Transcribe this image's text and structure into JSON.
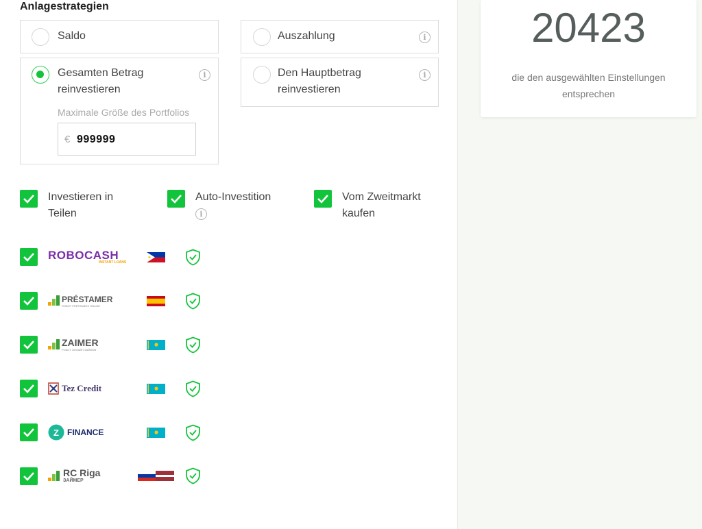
{
  "section_title": "Anlagestrategien",
  "strategies": {
    "saldo": "Saldo",
    "auszahlung": "Auszahlung",
    "gesamt": "Gesamten Betrag reinvestieren",
    "haupt": "Den Hauptbetrag reinvestieren"
  },
  "portfolio": {
    "label": "Maximale Größe des Portfolios",
    "currency": "€",
    "value": "999999"
  },
  "options": {
    "teilen": "Investieren in Teilen",
    "auto": "Auto-Investition",
    "zweitmarkt": "Vom Zweitmarkt kaufen"
  },
  "lenders": [
    {
      "name": "ROBOCASH",
      "tagline": "INSTANT LOANS",
      "flag": "philippines"
    },
    {
      "name": "PRÉSTAMER",
      "tagline": "ROBOT PRÉSTAMOS ONLINE",
      "flag": "spain"
    },
    {
      "name": "ZAIMER",
      "tagline": "РОБОТ ОНЛАЙН ЗАЙМОВ",
      "flag": "kazakhstan"
    },
    {
      "name": "Tez Credit",
      "tagline": "",
      "flag": "kazakhstan"
    },
    {
      "name": "FINANCE",
      "tagline": "",
      "flag": "kazakhstan"
    },
    {
      "name": "RC Riga",
      "tagline": "ЗАЙМЕР",
      "flag": "russia-latvia"
    }
  ],
  "summary": {
    "count": "20423",
    "description": "die den ausgewählten Einstellungen entsprechen"
  },
  "colors": {
    "accent_green": "#12c43b",
    "robocash_purple": "#7b2fa8",
    "zfinance_teal": "#1cb897"
  }
}
